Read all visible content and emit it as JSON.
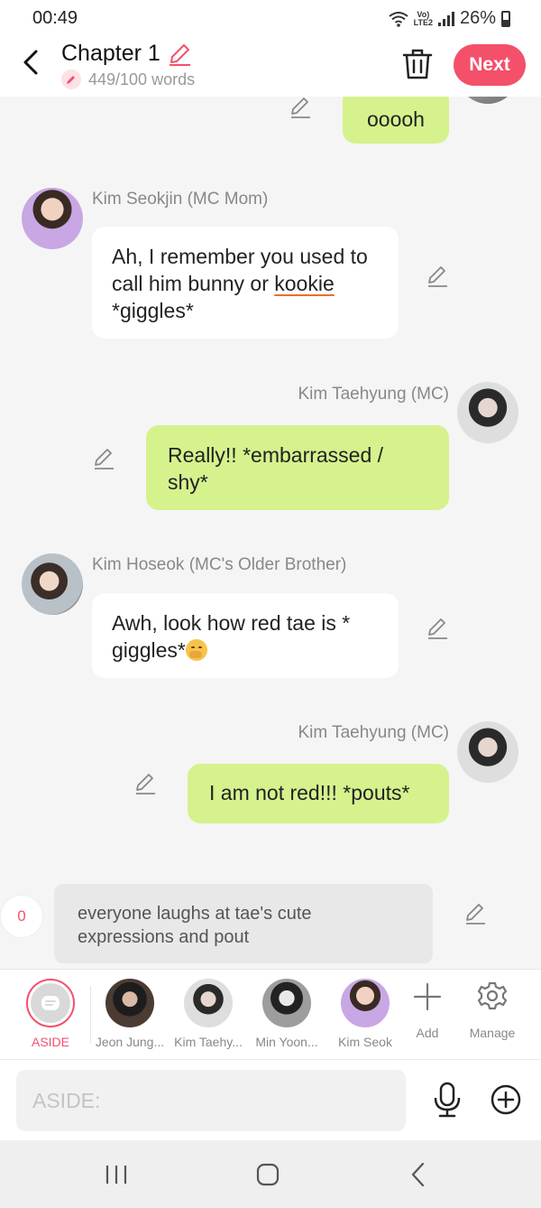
{
  "status": {
    "time": "00:49",
    "battery": "26%",
    "network_top": "Vo)",
    "network_bottom": "LTE2"
  },
  "header": {
    "title": "Chapter 1",
    "word_count": "449/100 words",
    "next_label": "Next"
  },
  "messages": [
    {
      "side": "me",
      "text": "ooooh"
    },
    {
      "side": "other",
      "speaker": "Kim Seokjin (MC Mom)",
      "text_a": "Ah, I remember you used to call him bunny or ",
      "text_underlined": "kookie",
      "text_b": " *giggles*"
    },
    {
      "side": "me",
      "speaker": "Kim Taehyung (MC)",
      "text": "Really!! *embarrassed / shy*"
    },
    {
      "side": "other",
      "speaker": "Kim Hoseok (MC's Older Brother)",
      "text": "Awh, look how red tae is * giggles*"
    },
    {
      "side": "me",
      "speaker": "Kim Taehyung (MC)",
      "text": "I am not red!!! *pouts*"
    }
  ],
  "aside": {
    "count": "0",
    "text": "everyone laughs at tae's cute expressions and pout"
  },
  "characters": [
    {
      "label": "ASIDE"
    },
    {
      "label": "Jeon Jung..."
    },
    {
      "label": "Kim Taehy..."
    },
    {
      "label": "Min Yoon..."
    },
    {
      "label": "Kim Seok"
    },
    {
      "label": "Add"
    },
    {
      "label": "Manage"
    }
  ],
  "input": {
    "placeholder": "ASIDE:"
  },
  "colors": {
    "accent": "#f4506a",
    "my_bubble": "#d5f28d",
    "other_bubble": "#ffffff",
    "background": "#f5f5f5"
  }
}
